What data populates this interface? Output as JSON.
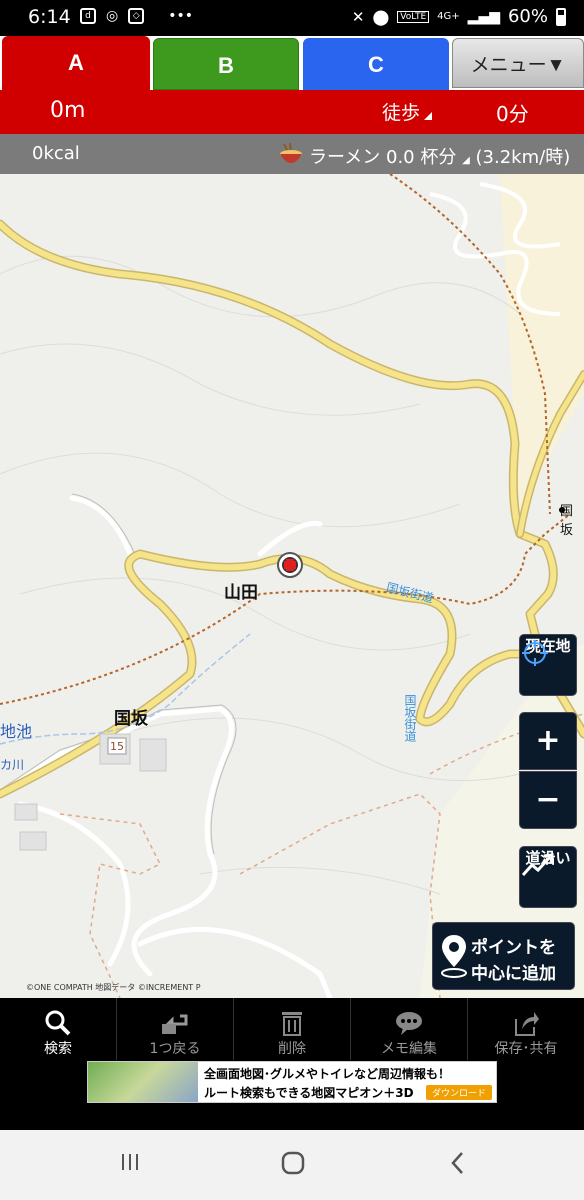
{
  "status": {
    "time": "6:14",
    "network": "4G+",
    "battery": "60%"
  },
  "tabs": {
    "a": "A",
    "b": "B",
    "c": "C",
    "menu": "メニュー▼"
  },
  "route": {
    "distance": "0m",
    "mode": "徒歩",
    "time": "0分"
  },
  "calories": {
    "kcal": "0kcal",
    "ramen_text": "ラーメン 0.0 杯分",
    "speed": "(3.2km/時)"
  },
  "map": {
    "labels": {
      "yamada": "山田",
      "kunisaka": "国坂",
      "kunisaka_edge": "国坂",
      "chiike": "地池",
      "kawa": "カ川",
      "route15": "15",
      "kaido_top": "国坂街道",
      "kaido_side": "国坂街道"
    },
    "copyright": "©ONE COMPATH 地図データ ©INCREMENT P"
  },
  "buttons": {
    "current_location": "現在地",
    "zoom_in": "+",
    "zoom_out": "−",
    "along_road": "道沿い",
    "add_point_line1": "ポイントを",
    "add_point_line2": "中心に追加"
  },
  "toolbar": {
    "search": "検索",
    "undo": "1つ戻る",
    "delete": "削除",
    "memo": "メモ編集",
    "save": "保存･共有"
  },
  "ad": {
    "line1": "全画面地図･グルメやトイレなど周辺情報も！",
    "line2": "ルート検索もできる地図マピオン＋3D",
    "download": "ダウンロード"
  },
  "colors": {
    "tab_a": "#d10000",
    "tab_b": "#3e9a1f",
    "tab_c": "#2a65f0",
    "road_yellow": "#f6e48a"
  }
}
